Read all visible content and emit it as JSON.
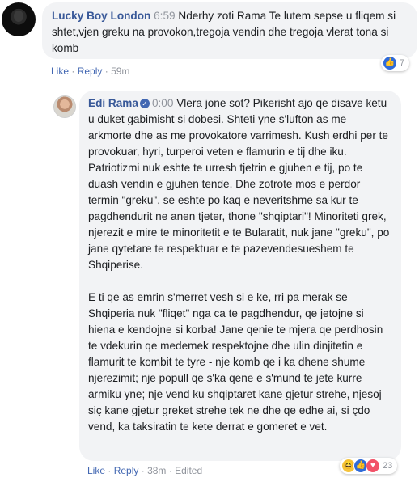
{
  "comment1": {
    "author": "Lucky Boy London",
    "timestamp": "6:59",
    "text": "Nderhy zoti Rama Te lutem sepse u fliqem si shtet,vjen greku na provokon,tregoja vendin dhe tregoja vlerat tona si komb",
    "actions": {
      "like": "Like",
      "reply": "Reply",
      "age": "59m"
    },
    "reactions": {
      "icons": [
        "like-icon"
      ],
      "count": "7"
    }
  },
  "comment2": {
    "author": "Edi Rama",
    "verified_icon": "verified-badge-icon",
    "timestamp": "0:00",
    "paragraph1": "Vlera jone sot? Pikerisht ajo qe disave ketu u duket gabimisht si dobesi. Shteti yne s'lufton as me arkmorte dhe as me provokatore varrimesh. Kush erdhi per te provokuar, hyri, turperoi veten e flamurin e tij dhe iku. Patriotizmi nuk eshte te urresh tjetrin e gjuhen e tij, po te duash vendin e gjuhen tende. Dhe zotrote mos e perdor termin \"greku\", se eshte po kaq e neveritshme sa kur te pagdhendurit ne anen tjeter, thone \"shqiptari\"! Minoriteti grek, njerezit e mire te minoritetit e te Bularatit, nuk jane \"greku\", po jane qytetare te respektuar e te pazevendesueshem te Shqiperise.",
    "paragraph2": "E ti qe as emrin s'merret vesh si e ke, rri pa merak se Shqiperia nuk \"fliqet\" nga ca te pagdhendur, qe jetojne si hiena e kendojne si korba! Jane qenie te mjera qe perdhosin te vdekurin qe medemek respektojne dhe ulin dinjitetin e flamurit te kombit te tyre - nje komb qe i ka dhene shume njerezimit; nje popull qe s'ka qene e s'mund te jete kurre armiku yne; nje vend ku shqiptaret kane gjetur strehe, njesoj siç kane gjetur greket strehe tek ne dhe qe edhe ai, si çdo vend, ka taksiratin te kete derrat e gomeret e vet.",
    "actions": {
      "like": "Like",
      "reply": "Reply",
      "age": "38m",
      "edited": "Edited"
    },
    "reactions": {
      "icons": [
        "haha-icon",
        "like-icon",
        "love-icon"
      ],
      "count": "23"
    }
  },
  "separator": "·",
  "colors": {
    "link": "#385898",
    "meta": "#90949c",
    "bubble": "#f2f3f5",
    "like": "#2f6bd9",
    "love": "#f25268",
    "haha": "#f5c33b"
  }
}
